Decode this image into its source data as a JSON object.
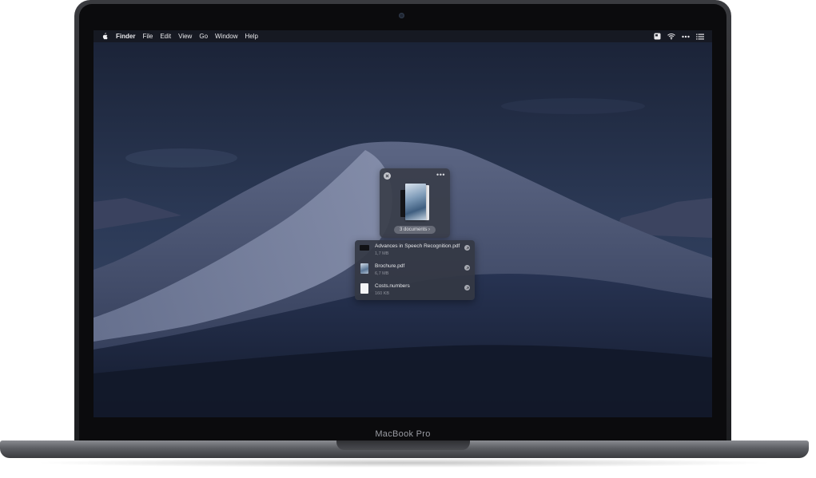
{
  "device": {
    "brand_label": "MacBook Pro"
  },
  "menubar": {
    "app_name": "Finder",
    "items": [
      "File",
      "Edit",
      "View",
      "Go",
      "Window",
      "Help"
    ],
    "status_icons": [
      "notes-widget-icon",
      "wifi-icon",
      "more-dots-icon",
      "list-icon"
    ]
  },
  "shelf": {
    "more_label": "•••",
    "count_label": "3 documents ›"
  },
  "files": [
    {
      "name": "Advances in Speech Recognition.pdf",
      "size": "1,7 MB",
      "thumb": "dark"
    },
    {
      "name": "Brochure.pdf",
      "size": "6,7 MB",
      "thumb": "photo"
    },
    {
      "name": "Costs.numbers",
      "size": "160 KB",
      "thumb": "white"
    }
  ],
  "colors": {
    "accent": "#2b6fd6",
    "screen_bg": "#1c2539"
  }
}
